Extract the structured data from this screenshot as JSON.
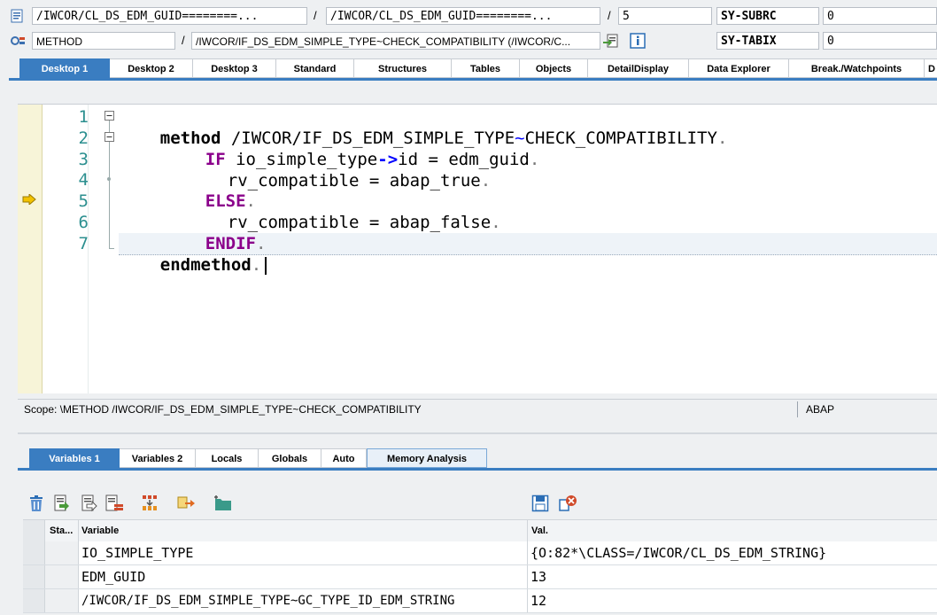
{
  "header": {
    "row1": {
      "program_field": "/IWCOR/CL_DS_EDM_GUID========...",
      "include_field": "/IWCOR/CL_DS_EDM_GUID========...",
      "line_field": "5",
      "sep1": "/",
      "sep2": "/",
      "sys_field_label": "SY-SUBRC",
      "sys_field_value": "0"
    },
    "row2": {
      "event_type": "METHOD",
      "sep": "/",
      "event_name": "/IWCOR/IF_DS_EDM_SIMPLE_TYPE~CHECK_COMPATIBILITY (/IWCOR/C...",
      "sys_field_label": "SY-TABIX",
      "sys_field_value": "0"
    }
  },
  "desktop_tabs": [
    "Desktop 1",
    "Desktop 2",
    "Desktop 3",
    "Standard",
    "Structures",
    "Tables",
    "Objects",
    "DetailDisplay",
    "Data Explorer",
    "Break./Watchpoints",
    "D"
  ],
  "code": {
    "line_numbers": [
      "1",
      "2",
      "3",
      "4",
      "5",
      "6",
      "7"
    ],
    "l1_kw": "method",
    "l1_rest": " /IWCOR/IF_DS_EDM_SIMPLE_TYPE",
    "l1_tilde": "~",
    "l1_name": "CHECK_COMPATIBILITY",
    "l1_dot": ".",
    "l2_kw": "IF",
    "l2_a": " io_simple_type",
    "l2_arrow": "->",
    "l2_b": "id = edm_guid",
    "l2_dot": ".",
    "l3_text": "rv_compatible = abap_true",
    "l3_dot": ".",
    "l4_kw": "ELSE",
    "l4_dot": ".",
    "l5_text": "rv_compatible = abap_false",
    "l5_dot": ".",
    "l6_kw": "ENDIF",
    "l6_dot": ".",
    "l7_kw": "endmethod",
    "l7_dot": ".",
    "current_line": 5
  },
  "scope": {
    "label": "Scope: \\METHOD /IWCOR/IF_DS_EDM_SIMPLE_TYPE~CHECK_COMPATIBILITY",
    "language": "ABAP"
  },
  "variable_tabs": [
    "Variables 1",
    "Variables 2",
    "Locals",
    "Globals",
    "Auto",
    "Memory Analysis"
  ],
  "variables_table": {
    "headers": {
      "status": "Sta...",
      "variable": "Variable",
      "value": "Val."
    },
    "rows": [
      {
        "variable": "IO_SIMPLE_TYPE",
        "value": "{O:82*\\CLASS=/IWCOR/CL_DS_EDM_STRING}"
      },
      {
        "variable": "EDM_GUID",
        "value": "13"
      },
      {
        "variable": "/IWCOR/IF_DS_EDM_SIMPLE_TYPE~GC_TYPE_ID_EDM_STRING",
        "value": "12"
      }
    ]
  },
  "colors": {
    "active_tab": "#3a7dc1",
    "keyword": "#0000ff",
    "keyword_control": "#8b008b",
    "line_number": "#2b8f8f"
  },
  "icons": [
    "program-icon",
    "event-icon",
    "navigate-icon",
    "info-icon",
    "delete-icon",
    "insert-row-icon",
    "import-icon",
    "export-icon",
    "sort-icon",
    "transfer-icon",
    "folder-icon",
    "save-icon",
    "reset-icon",
    "breakpoint-arrow-icon"
  ]
}
